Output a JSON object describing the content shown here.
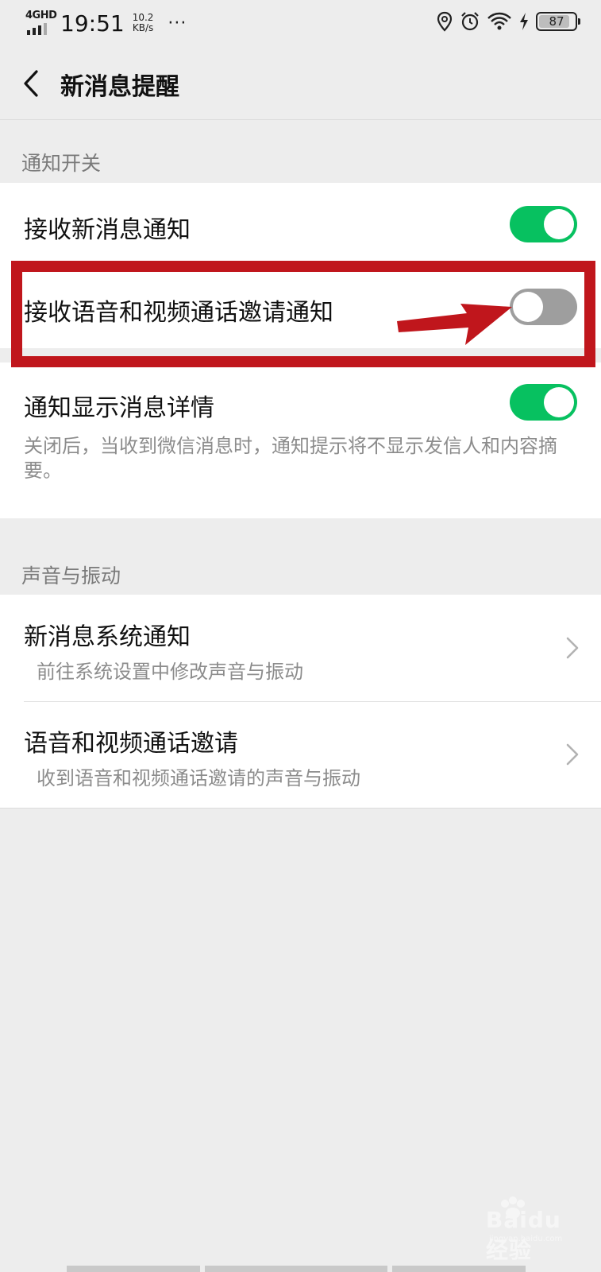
{
  "status_bar": {
    "network": "4GHD",
    "time": "19:51",
    "speed_value": "10.2",
    "speed_unit": "KB/s",
    "more": "···",
    "battery": "87",
    "battery_level": 0.87
  },
  "header": {
    "title": "新消息提醒"
  },
  "sections": {
    "notify": {
      "title": "通知开关",
      "items": [
        {
          "label": "接收新消息通知",
          "toggle": true
        },
        {
          "label": "接收语音和视频通话邀请通知",
          "toggle": false
        },
        {
          "label": "通知显示消息详情",
          "toggle": true,
          "description": "关闭后，当收到微信消息时，通知提示将不显示发信人和内容摘要。"
        }
      ]
    },
    "sound": {
      "title": "声音与振动",
      "items": [
        {
          "label": "新消息系统通知",
          "description": "前往系统设置中修改声音与振动"
        },
        {
          "label": "语音和视频通话邀请",
          "description": "收到语音和视频通话邀请的声音与振动"
        }
      ]
    }
  },
  "colors": {
    "toggle_on": "#07c160",
    "toggle_off": "#9e9e9e",
    "highlight": "#c0161c"
  },
  "watermark": {
    "text": "Baidu经验",
    "sub": "jingyan.baidu.com"
  }
}
